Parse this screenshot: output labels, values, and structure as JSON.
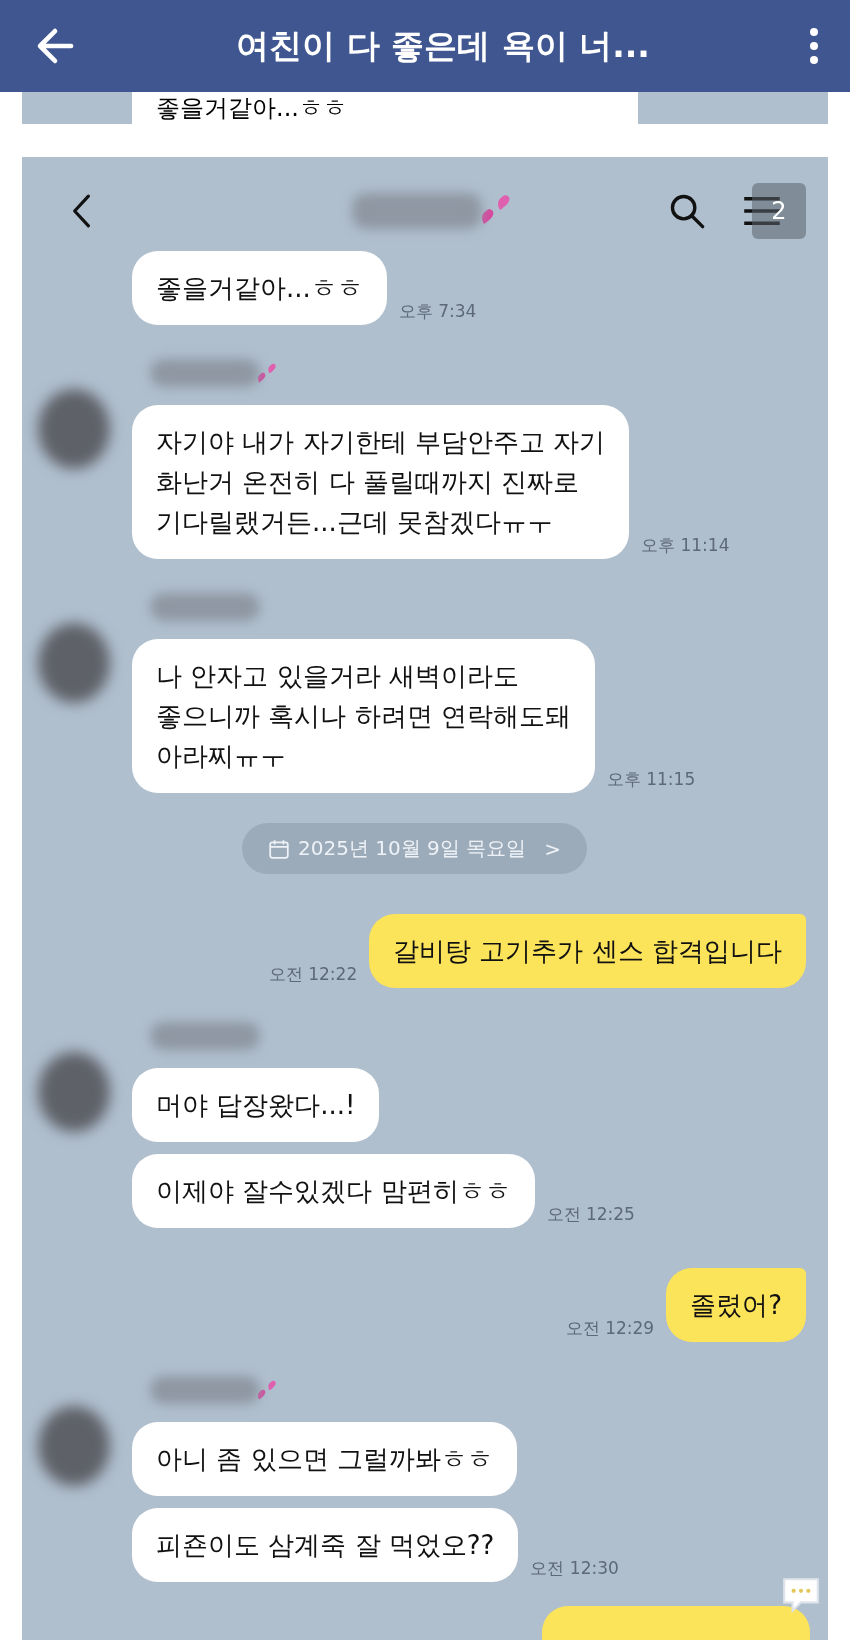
{
  "header": {
    "title": "여친이 다 좋은데 욕이 너..."
  },
  "previous_fragment": {
    "text": "좋을거같아...ㅎㅎ"
  },
  "chat": {
    "unread_badge": "2",
    "items": [
      {
        "kind": "received",
        "avatar": false,
        "hearts": false,
        "bubbles": [
          "좋을거같아...ㅎㅎ"
        ],
        "time": "오후 7:34"
      },
      {
        "kind": "received",
        "avatar": true,
        "hearts": true,
        "bubbles": [
          "자기야 내가 자기한테 부담안주고 자기\n화난거 온전히 다 풀릴때까지 진짜로\n기다릴랬거든...근데 못참겠다ㅠㅜ"
        ],
        "time": "오후 11:14"
      },
      {
        "kind": "received",
        "avatar": true,
        "hearts": false,
        "bubbles": [
          "나 안자고 있을거라 새벽이라도\n좋으니까 혹시나 하려면 연락해도돼\n아라찌ㅠㅜ"
        ],
        "time": "오후 11:15"
      },
      {
        "kind": "date",
        "text": "2025년 10월 9일 목요일",
        "chevron": ">"
      },
      {
        "kind": "sent",
        "bubbles": [
          "갈비탕 고기추가 센스 합격입니다"
        ],
        "time": "오전 12:22"
      },
      {
        "kind": "received",
        "avatar": true,
        "hearts": false,
        "bubbles": [
          "머야 답장왔다...!",
          "이제야 잘수있겠다 맘편히ㅎㅎ"
        ],
        "time": "오전 12:25"
      },
      {
        "kind": "sent",
        "bubbles": [
          "졸렸어?"
        ],
        "time": "오전 12:29"
      },
      {
        "kind": "received",
        "avatar": true,
        "hearts": true,
        "bubbles": [
          "아니 좀 있으면 그럴까봐ㅎㅎ",
          "피죤이도 삼계죽 잘 먹었오??"
        ],
        "time": "오전 12:30"
      },
      {
        "kind": "sent_cut"
      }
    ]
  }
}
